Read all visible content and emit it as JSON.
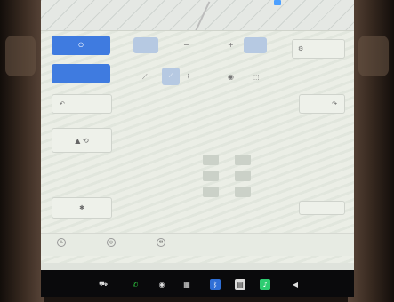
{
  "map": {
    "street_label": ""
  },
  "controls": {
    "power_icon": "power-icon",
    "mode_button": "",
    "climate_pale_button": "",
    "fan_up_symbol": "+",
    "fan_down_symbol": "−",
    "active_pale_button": "",
    "right_pill_label": "",
    "left_wiper_icon": "wiper-icon",
    "right_wiper_icon": "wiper-icon",
    "seat_heat_icon": "seat-heat-icon",
    "defrost_icon": "defrost-icon",
    "small_button": ""
  },
  "seat_grid": {
    "seats": [
      {
        "label": "",
        "level": 0
      },
      {
        "label": "",
        "level": 0
      },
      {
        "label": "",
        "level": 0
      },
      {
        "label": "",
        "level": 0
      },
      {
        "label": "",
        "level": 0
      },
      {
        "label": "",
        "level": 0
      }
    ]
  },
  "bottom_bar": {
    "items": [
      {
        "icon": "person-icon",
        "label": ""
      },
      {
        "icon": "steering-icon",
        "label": ""
      },
      {
        "icon": "wrench-icon",
        "label": ""
      },
      {
        "icon": "",
        "label": ""
      }
    ]
  },
  "dock": {
    "items": [
      {
        "icon": "car-icon",
        "color": "#cccccc"
      },
      {
        "icon": "phone-icon",
        "color": "#2ecc40"
      },
      {
        "icon": "camera-icon",
        "color": "#bbbbbb"
      },
      {
        "icon": "app-icon",
        "color": "#bbbbbb"
      },
      {
        "icon": "bluetooth-icon",
        "color": "#2f6fd6"
      },
      {
        "icon": "files-icon",
        "color": "#dddddd"
      },
      {
        "icon": "spotify-icon",
        "color": "#2ecc71"
      },
      {
        "icon": "volume-icon",
        "color": "#dddddd"
      }
    ]
  }
}
